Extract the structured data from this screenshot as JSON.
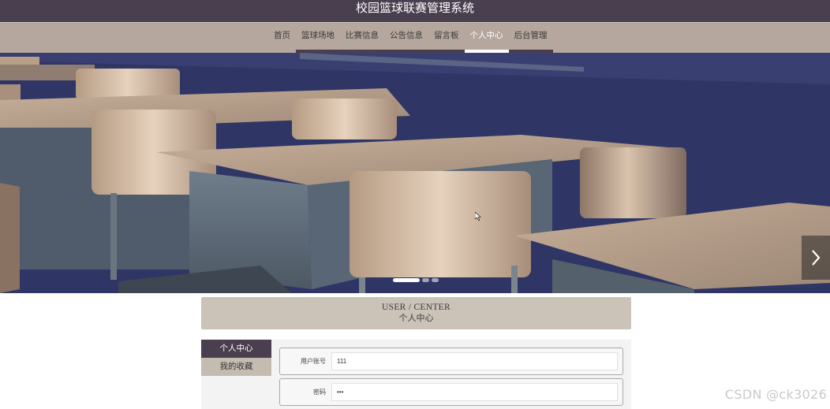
{
  "header": {
    "title": "校园篮球联赛管理系统"
  },
  "nav": {
    "items": [
      {
        "label": "首页"
      },
      {
        "label": "篮球场地"
      },
      {
        "label": "比赛信息"
      },
      {
        "label": "公告信息"
      },
      {
        "label": "留言板"
      },
      {
        "label": "个人中心"
      },
      {
        "label": "后台管理"
      }
    ],
    "active_index": 5
  },
  "banner": {
    "slide_count": 3,
    "active_slide": 1
  },
  "section": {
    "title_en": "USER / CENTER",
    "title_zh": "个人中心"
  },
  "side_menu": {
    "items": [
      {
        "label": "个人中心"
      },
      {
        "label": "我的收藏"
      }
    ]
  },
  "form": {
    "fields": [
      {
        "label": "用户账号",
        "value": "111"
      },
      {
        "label": "密码",
        "value": "•••"
      }
    ]
  },
  "watermark": {
    "text": "CSDN @ck3026"
  },
  "colors": {
    "header_bg": "#4a3f4f",
    "nav_bg": "#b5a79d",
    "section_bg": "#cbc2b8",
    "side_active": "#4a3f4f",
    "side_normal": "#c5bcb1"
  }
}
